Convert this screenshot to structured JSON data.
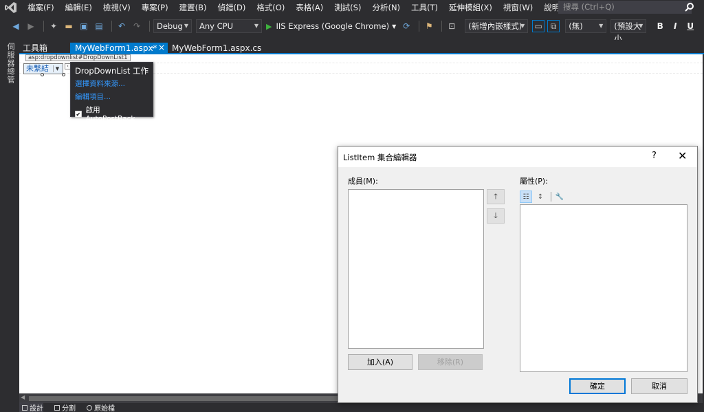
{
  "menu": {
    "items": [
      "檔案(F)",
      "編輯(E)",
      "檢視(V)",
      "專案(P)",
      "建置(B)",
      "偵錯(D)",
      "格式(O)",
      "表格(A)",
      "測試(S)",
      "分析(N)",
      "工具(T)",
      "延伸模組(X)",
      "視窗(W)",
      "說明(H)"
    ],
    "search_placeholder": "搜尋 (Ctrl+Q)"
  },
  "toolbar": {
    "config": "Debug",
    "platform": "Any CPU",
    "run_target": "IIS Express (Google Chrome)",
    "block_format": "(新增內嵌樣式)",
    "style": "(無)",
    "font_size": "(預設大小",
    "bold": "B",
    "italic": "I",
    "underline": "U"
  },
  "side": {
    "label": "伺服器總管"
  },
  "tabs": {
    "toolbox": "工具箱",
    "active": "MyWebForm1.aspx*",
    "code_behind": "MyWebForm1.aspx.cs"
  },
  "designer": {
    "control_tag": "asp:dropdownlist#DropDownList1",
    "dropdown_text": "未繫結",
    "tasks": {
      "title": "DropDownList 工作",
      "choose_source": "選擇資料來源...",
      "edit_items": "編輯項目...",
      "autopostback": "啟用 AutoPostBack"
    }
  },
  "viewbar": {
    "design": "設計",
    "split": "分割",
    "source": "原始檔"
  },
  "dialog": {
    "title": "ListItem 集合編輯器",
    "help": "?",
    "members_label": "成員(M):",
    "properties_label": "屬性(P):",
    "add_button": "加入(A)",
    "remove_button": "移除(R)",
    "ok_button": "確定",
    "cancel_button": "取消"
  }
}
